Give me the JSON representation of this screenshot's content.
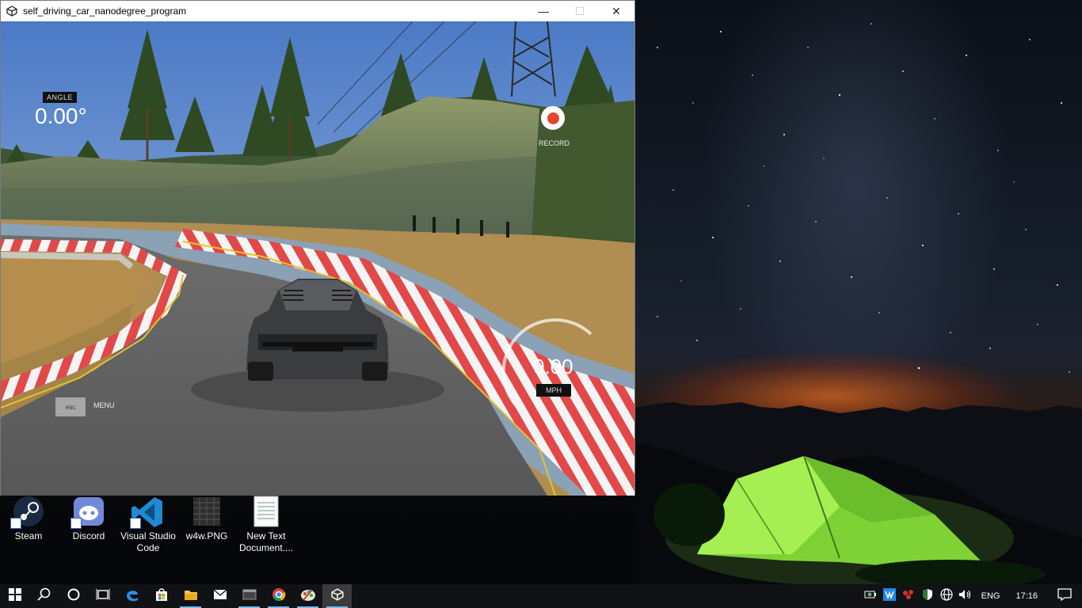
{
  "window": {
    "title": "self_driving_car_nanodegree_program",
    "controls": {
      "minimize": "—",
      "maximize": "☐",
      "close": "✕"
    }
  },
  "hud": {
    "angle_label": "ANGLE",
    "angle_value": "0.00°",
    "record_label": "RECORD",
    "speed_value": "0.00",
    "speed_unit": "MPH",
    "esc_key": "esc",
    "esc_label": "MENU"
  },
  "desktop": {
    "icons": [
      {
        "label": "Steam",
        "icon": "steam-icon"
      },
      {
        "label": "Discord",
        "icon": "discord-icon"
      },
      {
        "label": "Visual Studio Code",
        "icon": "vscode-icon"
      },
      {
        "label": "w4w.PNG",
        "icon": "image-file-icon"
      },
      {
        "label": "New Text Document....",
        "icon": "text-file-icon"
      }
    ]
  },
  "taskbar": {
    "apps": [
      "start-icon",
      "search-icon",
      "cortana-icon",
      "task-view-icon",
      "edge-icon",
      "store-icon",
      "file-explorer-icon",
      "mail-icon",
      "terminal-icon",
      "chrome-icon",
      "paint-icon",
      "unity-icon"
    ],
    "tray_icons": [
      "battery-saver-icon",
      "tray-app-icon",
      "people-icon",
      "defender-icon",
      "network-icon",
      "volume-icon"
    ],
    "language": "ENG",
    "time": "17:16"
  },
  "colors": {
    "record_red": "#e8432e",
    "curb_red": "#e24848",
    "taskbar_bg": "#101216",
    "tent_green": "#8fe13a"
  }
}
